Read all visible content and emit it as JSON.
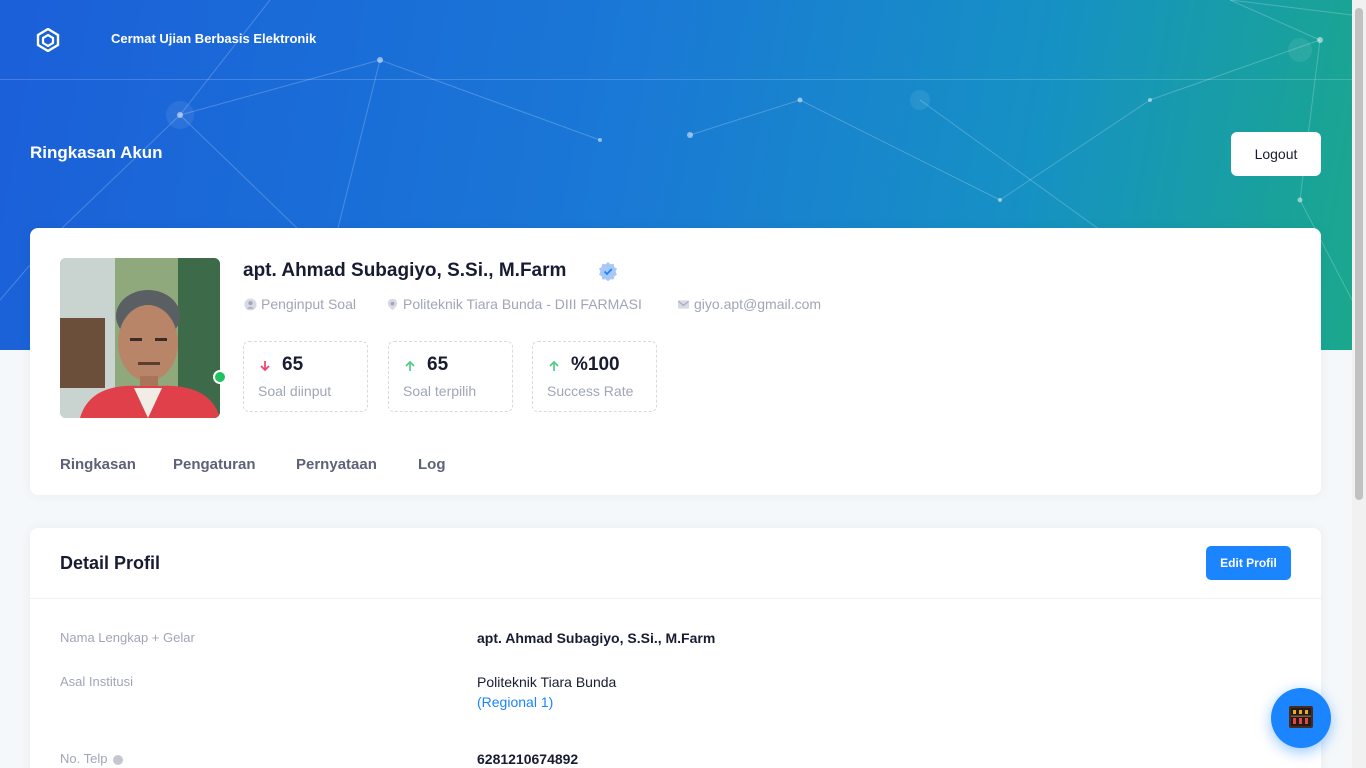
{
  "header": {
    "brand": "Cermat Ujian Berbasis Elektronik",
    "page_title": "Ringkasan Akun",
    "logout_label": "Logout"
  },
  "profile": {
    "name": "apt. Ahmad Subagiyo, S.Si., M.Farm",
    "role": "Penginput Soal",
    "institution": "Politeknik Tiara Bunda - DIII FARMASI",
    "email": "giyo.apt@gmail.com",
    "online": true,
    "stats": [
      {
        "value": "65",
        "label": "Soal diinput",
        "trend": "down",
        "trend_color": "#f1416c"
      },
      {
        "value": "65",
        "label": "Soal terpilih",
        "trend": "up",
        "trend_color": "#50cd89"
      },
      {
        "value": "%100",
        "label": "Success Rate",
        "trend": "up",
        "trend_color": "#50cd89"
      }
    ],
    "tabs": [
      "Ringkasan",
      "Pengaturan",
      "Pernyataan",
      "Log"
    ]
  },
  "detail": {
    "title": "Detail Profil",
    "edit_label": "Edit Profil",
    "rows": [
      {
        "label": "Nama Lengkap + Gelar",
        "value": "apt. Ahmad Subagiyo, S.Si., M.Farm"
      },
      {
        "label": "Asal Institusi",
        "value": "Politeknik Tiara Bunda",
        "sub": "(Regional 1)"
      },
      {
        "label": "No. Telp",
        "value": "6281210674892"
      }
    ]
  },
  "colors": {
    "accent": "#1b84ff",
    "online": "#20c15f"
  }
}
